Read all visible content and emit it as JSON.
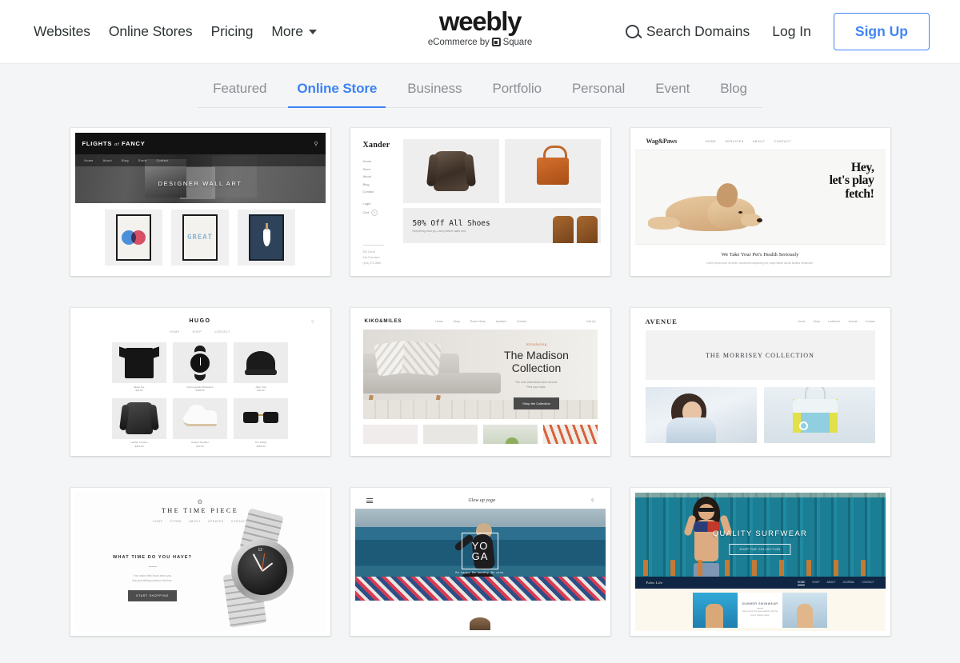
{
  "header": {
    "nav": [
      {
        "label": "Websites"
      },
      {
        "label": "Online Stores"
      },
      {
        "label": "Pricing"
      },
      {
        "label": "More"
      }
    ],
    "logo": {
      "word": "weebly",
      "tagline_before": "eCommerce by",
      "tagline_after": "Square"
    },
    "search_domains": "Search Domains",
    "login": "Log In",
    "signup": "Sign Up",
    "accent_color": "#4285f4"
  },
  "tabs": {
    "active": "Online Store",
    "items": [
      {
        "label": "Featured"
      },
      {
        "label": "Online Store"
      },
      {
        "label": "Business"
      },
      {
        "label": "Portfolio"
      },
      {
        "label": "Personal"
      },
      {
        "label": "Event"
      },
      {
        "label": "Blog"
      }
    ],
    "active_color": "#3b82f6"
  },
  "templates": [
    {
      "name": "Flights of Fancy",
      "brand": "FLIGHTS",
      "brand_small": "of",
      "brand_rest": "FANCY",
      "nav": [
        "Home",
        "About",
        "Blog",
        "Store",
        "Contact"
      ],
      "hero_title": "DESIGNER WALL ART",
      "art": [
        "venn",
        "GREAT",
        "vase"
      ]
    },
    {
      "name": "Xander",
      "brand": "Xander",
      "nav": [
        "Home",
        "Store",
        "About",
        "Blog",
        "Contact"
      ],
      "account": [
        "Login"
      ],
      "cart_label": "Cart",
      "cart_count": "0",
      "address": [
        "300 2nd st",
        "San Francisco",
        "(415) 472-0580"
      ],
      "banner_title": "50% Off All Shoes",
      "banner_sub": "Everything must go—hurry before sales end."
    },
    {
      "name": "Wag & Paws",
      "brand": "Wag&Paws",
      "nav": [
        "HOME",
        "SERVICES",
        "ABOUT",
        "CONTACT"
      ],
      "headline_lines": [
        "Hey,",
        "let's play",
        "fetch!"
      ],
      "footer_title": "We Take Your Pet's Health Seriously",
      "footer_sub": "Lorem ipsum dolor sit amet, consectetur adipiscing elit, suspendisse iaculis facilisis vestibulum."
    },
    {
      "name": "Hugo",
      "brand": "HUGO",
      "nav": [
        "HOME",
        "SHOP",
        "CONTACT"
      ],
      "products": [
        {
          "title": "Black Tee",
          "price": "$24.00"
        },
        {
          "title": "Chronograph Wristwatch",
          "price": "$185.00"
        },
        {
          "title": "Allen Cap",
          "price": "$42.00"
        },
        {
          "title": "Leather Crusher",
          "price": "$312.00"
        },
        {
          "title": "Classic Sneaker",
          "price": "$72.00"
        },
        {
          "title": "The Shade",
          "price": "$158.00"
        }
      ]
    },
    {
      "name": "Kiko & Miles",
      "brand": "KIKO&MILES",
      "nav": [
        "Home",
        "Shop",
        "Room Ideas",
        "Updates",
        "Contact"
      ],
      "cart": "Cart (0)",
      "kicker": "Introducing",
      "title_lines": [
        "The Madison",
        "Collection"
      ],
      "sub_lines": [
        "The new collections have arrived.",
        "Find your style."
      ],
      "cta": "Shop the Collection"
    },
    {
      "name": "Avenue",
      "brand": "AVENUE",
      "nav": [
        "Home",
        "Shop",
        "Lookbook",
        "Journal",
        "Contact"
      ],
      "banner_title": "THE MORRISEY COLLECTION"
    },
    {
      "name": "The Time Piece",
      "brand": "THE TIME PIECE",
      "nav": [
        "HOME",
        "STORE",
        "ABOUT",
        "UPDATES",
        "CONTACT"
      ],
      "headline": "WHAT TIME DO YOU HAVE?",
      "body_lines": [
        "Your watch tells hours about you",
        "than just telling someone the time."
      ],
      "cta": "START SHOPPING"
    },
    {
      "name": "Yoga",
      "brand": "Glow up yoga",
      "box_lines": [
        "YO",
        "GA"
      ],
      "tagline": "Be happy. Be healthy. Be calm."
    },
    {
      "name": "Surfwear",
      "brand": "Palm Life",
      "hero_title": "QUALITY SURFWEAR",
      "hero_cta": "SHOP THE COLLECTION",
      "nav": [
        "HOME",
        "SHOP",
        "ABOUT",
        "JOURNAL",
        "CONTACT"
      ],
      "section_title": "SUMMER SWIMWEAR",
      "section_sub": "Gear up for the best weather with the year's hottest styles."
    }
  ]
}
